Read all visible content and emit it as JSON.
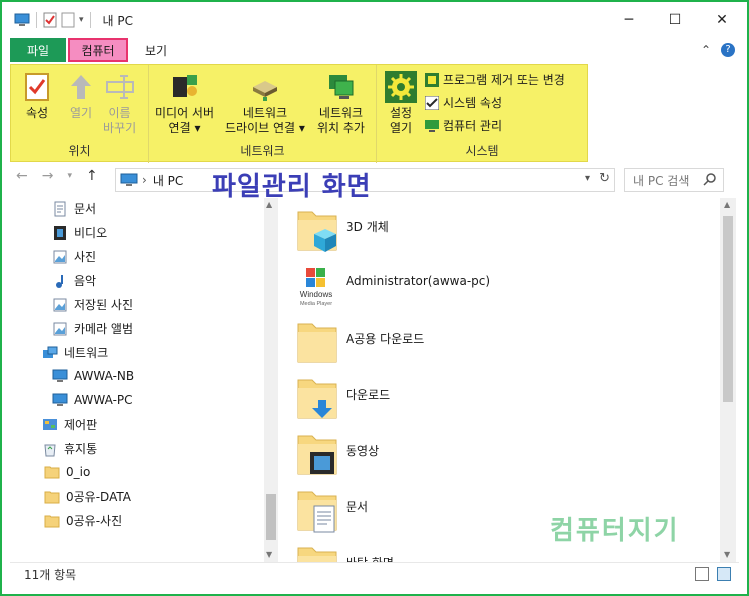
{
  "window": {
    "title": "내 PC"
  },
  "tabs": {
    "file": "파일",
    "computer": "컴퓨터",
    "view": "보기"
  },
  "ribbon": {
    "location": {
      "title": "위치",
      "properties": "속성",
      "open": "열기",
      "rename": [
        "이름",
        "바꾸기"
      ]
    },
    "network": {
      "title": "네트워크",
      "media_server": [
        "미디어 서버",
        "연결 ▾"
      ],
      "map_drive": [
        "네트워크",
        "드라이브 연결 ▾"
      ],
      "add_location": [
        "네트워크",
        "위치 추가"
      ]
    },
    "system": {
      "title": "시스템",
      "settings": [
        "설정",
        "열기"
      ],
      "uninstall": "프로그램 제거 또는 변경",
      "sys_props": "시스템 속성",
      "manage": "컴퓨터 관리"
    }
  },
  "address": {
    "path": "내 PC",
    "search_placeholder": "내 PC 검색"
  },
  "overlay_text": "파일관리 화면",
  "nav_items": [
    {
      "label": "문서",
      "icon": "document-icon"
    },
    {
      "label": "비디오",
      "icon": "video-icon"
    },
    {
      "label": "사진",
      "icon": "picture-icon"
    },
    {
      "label": "음악",
      "icon": "music-icon"
    },
    {
      "label": "저장된 사진",
      "icon": "picture-icon"
    },
    {
      "label": "카메라 앨범",
      "icon": "picture-icon"
    },
    {
      "label": "네트워크",
      "icon": "network-icon"
    },
    {
      "label": "AWWA-NB",
      "icon": "computer-icon"
    },
    {
      "label": "AWWA-PC",
      "icon": "computer-icon"
    },
    {
      "label": "제어판",
      "icon": "control-panel-icon"
    },
    {
      "label": "휴지통",
      "icon": "recycle-bin-icon"
    },
    {
      "label": "0_io",
      "icon": "folder-icon"
    },
    {
      "label": "0공유-DATA",
      "icon": "folder-icon"
    },
    {
      "label": "0공유-사진",
      "icon": "folder-icon"
    }
  ],
  "content_items": [
    {
      "label": "3D 개체",
      "icon": "3d-objects-folder-icon"
    },
    {
      "label": "Administrator(awwa-pc)",
      "icon": "windows-media-player-icon"
    },
    {
      "label": "A공용 다운로드",
      "icon": "folder-icon"
    },
    {
      "label": "다운로드",
      "icon": "downloads-folder-icon"
    },
    {
      "label": "동영상",
      "icon": "videos-folder-icon"
    },
    {
      "label": "문서",
      "icon": "documents-folder-icon"
    },
    {
      "label": "바탕 화면",
      "icon": "desktop-folder-icon"
    }
  ],
  "wmp_text": [
    "Windows",
    "Media Player"
  ],
  "watermark": "컴퓨터지기",
  "status": {
    "count": "11개 항목"
  },
  "colors": {
    "frame": "#1fb24b",
    "ribbon": "#f6f167",
    "file_tab": "#1d9a57",
    "computer_tab": "#f58dc1",
    "overlay": "#3b3eb6"
  }
}
